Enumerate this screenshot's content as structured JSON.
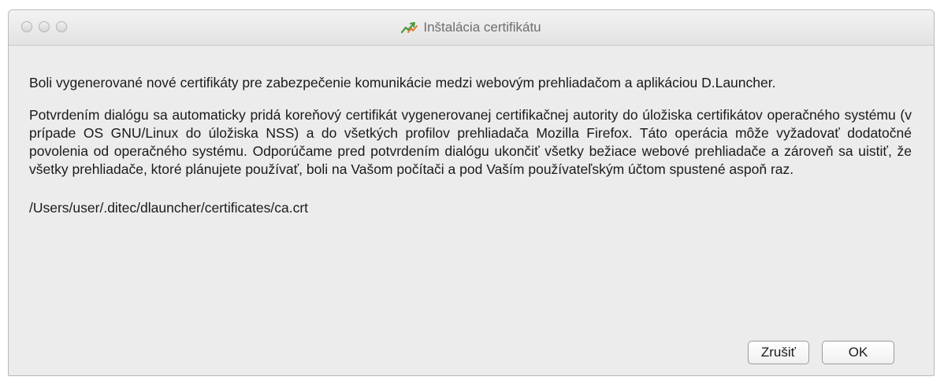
{
  "window": {
    "title": "Inštalácia certifikátu",
    "icon": "d-launcher-icon"
  },
  "content": {
    "paragraph1": "Boli vygenerované nové certifikáty pre zabezpečenie komunikácie medzi webovým prehliadačom a aplikáciou D.Launcher.",
    "paragraph2": "Potvrdením dialógu sa automaticky pridá koreňový certifikát vygenerovanej certifikačnej autority do úložiska certifikátov operačného systému (v prípade OS GNU/Linux do úložiska NSS) a do všetkých profilov prehliadača Mozilla Firefox. Táto operácia môže vyžadovať dodatočné povolenia od operačného systému. Odporúčame pred potvrdením dialógu ukončiť všetky bežiace webové prehliadače a zároveň sa uistiť, že všetky prehliadače, ktoré plánujete používať, boli na Vašom počítači a pod Vaším používateľským účtom spustené aspoň raz.",
    "path": "/Users/user/.ditec/dlauncher/certificates/ca.crt"
  },
  "buttons": {
    "cancel": "Zrušiť",
    "ok": "OK"
  }
}
